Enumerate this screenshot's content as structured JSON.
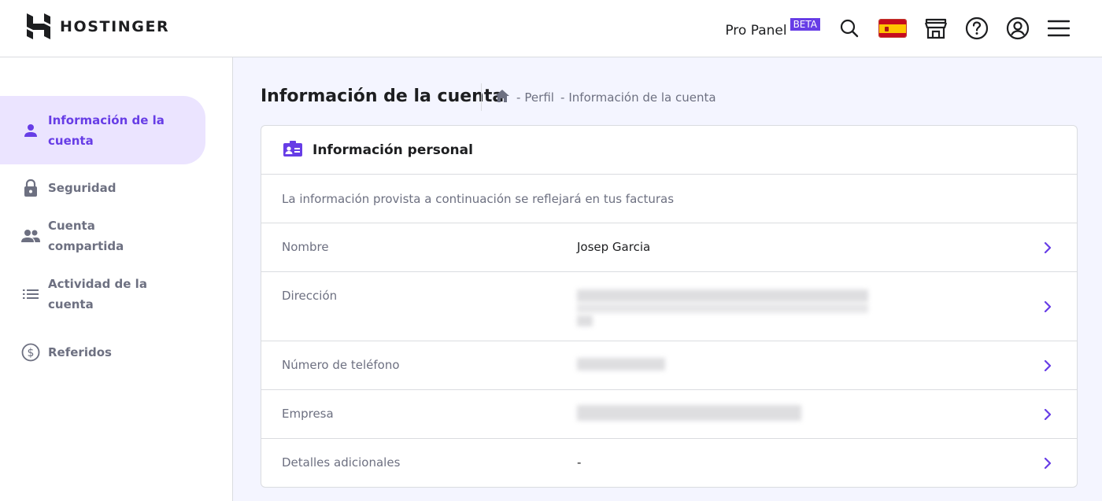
{
  "header": {
    "logo_text": "HOSTINGER",
    "pro_panel_label": "Pro Panel",
    "beta_label": "BETA",
    "icons": [
      "search-icon",
      "spain-flag-icon",
      "store-icon",
      "help-icon",
      "account-icon",
      "menu-icon"
    ]
  },
  "sidebar": {
    "items": [
      {
        "label": "Información de la cuenta",
        "icon": "person-icon",
        "active": true
      },
      {
        "label": "Seguridad",
        "icon": "lock-icon",
        "active": false
      },
      {
        "label": "Cuenta compartida",
        "icon": "people-icon",
        "active": false
      },
      {
        "label": "Actividad de la cuenta",
        "icon": "list-icon",
        "active": false
      },
      {
        "label": "Referidos",
        "icon": "dollar-circle-icon",
        "active": false
      }
    ]
  },
  "page": {
    "title": "Información de la cuenta",
    "breadcrumb": [
      "Perfil",
      "Información de la cuenta"
    ]
  },
  "card": {
    "title": "Información personal",
    "description": "La información provista a continuación se reflejará en tus facturas",
    "rows": [
      {
        "label": "Nombre",
        "value": "Josep Garcia"
      },
      {
        "label": "Dirección",
        "value": ""
      },
      {
        "label": "Número de teléfono",
        "value": ""
      },
      {
        "label": "Empresa",
        "value": ""
      },
      {
        "label": "Detalles adicionales",
        "value": "-"
      }
    ]
  },
  "colors": {
    "accent": "#673de6",
    "active_bg": "#ebe4ff",
    "page_bg": "#f4f5ff",
    "text_muted": "#6d7081"
  }
}
